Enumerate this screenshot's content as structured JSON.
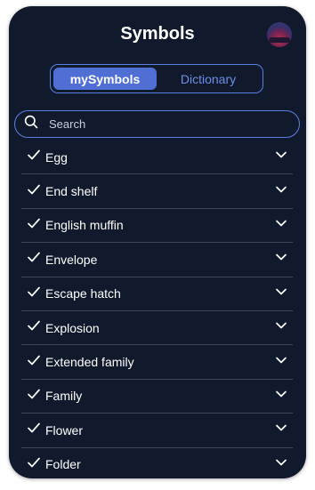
{
  "header": {
    "title": "Symbols"
  },
  "tabs": [
    {
      "label": "mySymbols",
      "active": true
    },
    {
      "label": "Dictionary",
      "active": false
    }
  ],
  "search": {
    "placeholder": "Search",
    "value": ""
  },
  "items": [
    {
      "label": "Egg"
    },
    {
      "label": "End shelf"
    },
    {
      "label": "English muffin"
    },
    {
      "label": "Envelope"
    },
    {
      "label": "Escape hatch"
    },
    {
      "label": "Explosion"
    },
    {
      "label": "Extended family"
    },
    {
      "label": "Family"
    },
    {
      "label": "Flower"
    },
    {
      "label": "Folder"
    }
  ],
  "colors": {
    "background": "#111a2c",
    "accent": "#4f6fd4",
    "divider": "#3c4658"
  }
}
